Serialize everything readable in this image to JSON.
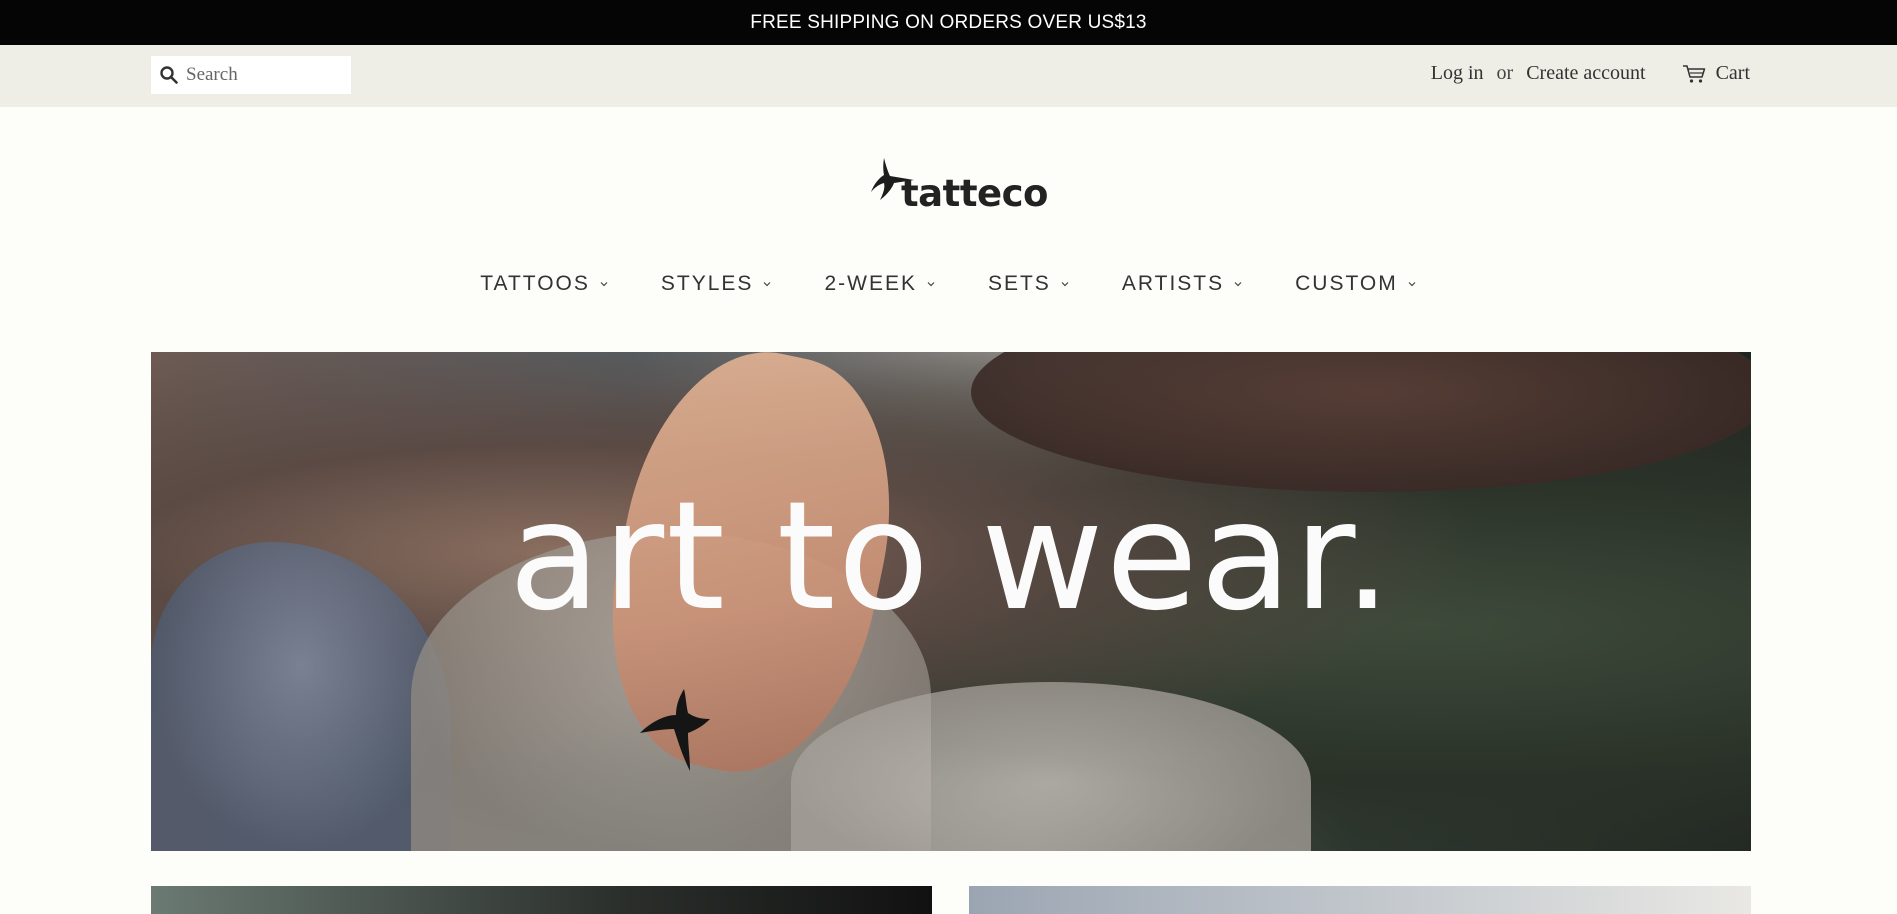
{
  "announcement": {
    "text": "FREE SHIPPING ON ORDERS OVER US$13"
  },
  "header": {
    "search": {
      "placeholder": "Search",
      "icon": "search-icon"
    },
    "login_label": "Log in",
    "or_label": "or",
    "create_account_label": "Create account",
    "cart": {
      "label": "Cart",
      "icon": "cart-icon"
    }
  },
  "logo": {
    "text": "tatteco",
    "icon": "hummingbird-icon"
  },
  "nav": {
    "items": [
      {
        "label": "TATTOOS"
      },
      {
        "label": "STYLES"
      },
      {
        "label": "2-WEEK"
      },
      {
        "label": "SETS"
      },
      {
        "label": "ARTISTS"
      },
      {
        "label": "CUSTOM"
      }
    ]
  },
  "hero": {
    "tagline": "art to wear."
  },
  "colors": {
    "announcement_bg": "#050505",
    "topbar_bg": "#eeede6",
    "page_bg": "#fdfdf9"
  }
}
